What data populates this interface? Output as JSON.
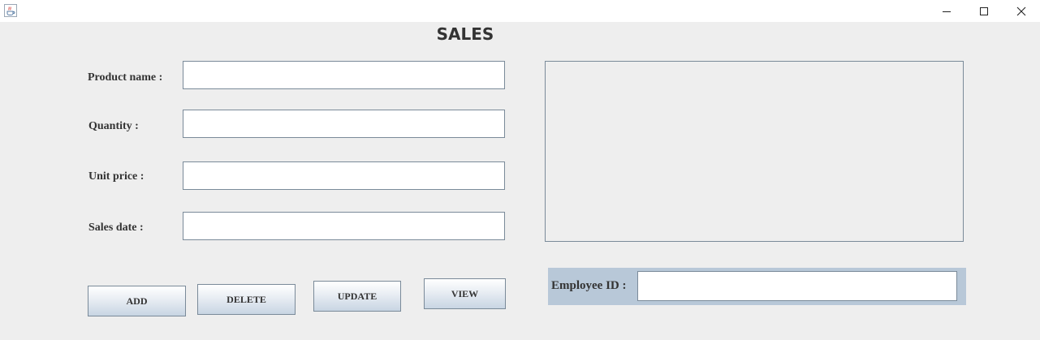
{
  "window": {
    "app_icon": "java-coffee-cup-icon",
    "controls": {
      "minimize_icon": "minimize-icon",
      "maximize_icon": "maximize-icon",
      "close_icon": "close-icon"
    }
  },
  "form": {
    "title": "SALES",
    "fields": {
      "product_name": {
        "label": "Product name :",
        "value": ""
      },
      "quantity": {
        "label": "Quantity :",
        "value": ""
      },
      "unit_price": {
        "label": "Unit price :",
        "value": ""
      },
      "sales_date": {
        "label": "Sales date :",
        "value": ""
      }
    },
    "display_area": {
      "value": ""
    },
    "buttons": {
      "add": "ADD",
      "delete": "DELETE",
      "update": "UPDATE",
      "view": "VIEW"
    },
    "employee": {
      "label": "Employee ID :",
      "value": ""
    }
  },
  "colors": {
    "background": "#eeeeee",
    "employee_panel": "#b8c8d8",
    "field_border": "#7a8a99"
  }
}
